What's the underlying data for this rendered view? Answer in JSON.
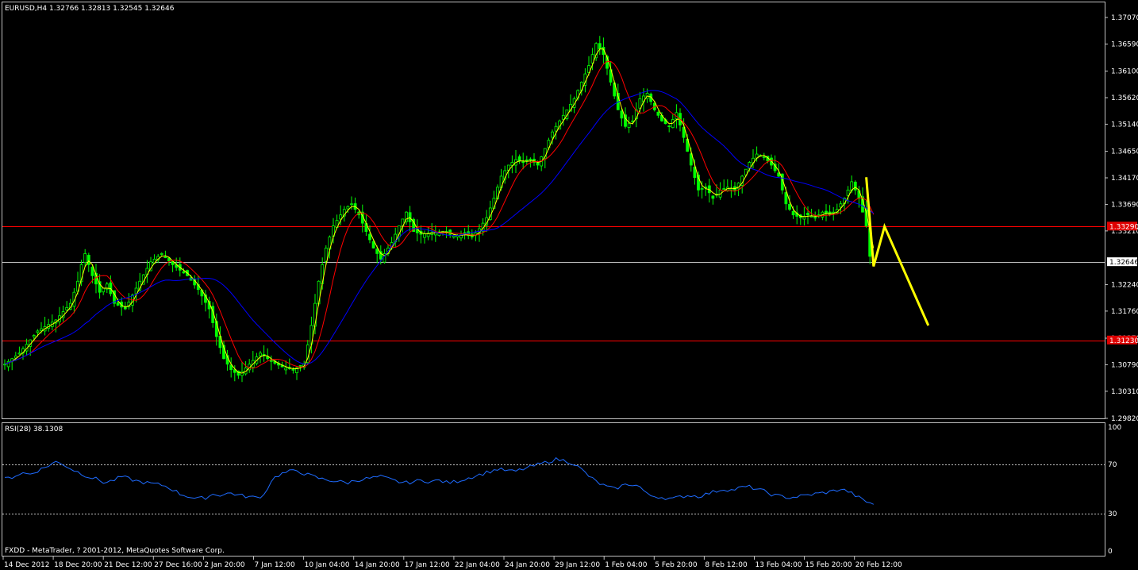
{
  "window": {
    "header": "EURUSD,H4  1.32766 1.32813 1.32545 1.32646",
    "indicator_header": "RSI(28) 38.1308",
    "footer": "FXDD - MetaTrader, ? 2001-2012, MetaQuotes Software Corp."
  },
  "colors": {
    "background": "#000000",
    "frame": "#c0c0c0",
    "candle": "#00ff00",
    "ma_fast": "#ffff00",
    "ma_mid": "#ff0000",
    "ma_slow": "#0000ff",
    "rsi": "#1e6bff",
    "level_line": "#ff0000",
    "current_line": "#c0c0c0",
    "drawing": "#ffff00"
  },
  "chart_data": [
    {
      "type": "candlestick",
      "symbol": "EURUSD",
      "timeframe": "H4",
      "ylim": [
        1.2982,
        1.373
      ],
      "y_ticks": [
        "1.37070",
        "1.36590",
        "1.36100",
        "1.35620",
        "1.35140",
        "1.34650",
        "1.34170",
        "1.33690",
        "1.33210",
        "1.32240",
        "1.31760",
        "1.31270",
        "1.30790",
        "1.30310",
        "1.29820"
      ],
      "y_tick_values": [
        1.3707,
        1.3659,
        1.361,
        1.3562,
        1.3514,
        1.3465,
        1.3417,
        1.3369,
        1.3321,
        1.3224,
        1.3176,
        1.3127,
        1.3079,
        1.3031,
        1.2982
      ],
      "x_ticks": [
        "14 Dec 2012",
        "18 Dec 20:00",
        "21 Dec 12:00",
        "27 Dec 16:00",
        "2 Jan 20:00",
        "7 Jan 12:00",
        "10 Jan 04:00",
        "14 Jan 20:00",
        "17 Jan 12:00",
        "22 Jan 04:00",
        "24 Jan 20:00",
        "29 Jan 12:00",
        "1 Feb 04:00",
        "5 Feb 20:00",
        "8 Feb 12:00",
        "13 Feb 04:00",
        "15 Feb 20:00",
        "20 Feb 12:00"
      ],
      "close_path": [
        [
          0,
          1.308
        ],
        [
          4,
          1.31
        ],
        [
          9,
          1.314
        ],
        [
          14,
          1.316
        ],
        [
          18,
          1.319
        ],
        [
          20,
          1.323
        ],
        [
          21,
          1.326
        ],
        [
          22,
          1.328
        ],
        [
          24,
          1.324
        ],
        [
          26,
          1.321
        ],
        [
          28,
          1.3225
        ],
        [
          30,
          1.319
        ],
        [
          33,
          1.318
        ],
        [
          37,
          1.323
        ],
        [
          40,
          1.3265
        ],
        [
          43,
          1.328
        ],
        [
          46,
          1.326
        ],
        [
          50,
          1.324
        ],
        [
          53,
          1.3215
        ],
        [
          56,
          1.318
        ],
        [
          58,
          1.313
        ],
        [
          60,
          1.309
        ],
        [
          62,
          1.307
        ],
        [
          64,
          1.306
        ],
        [
          67,
          1.308
        ],
        [
          70,
          1.31
        ],
        [
          73,
          1.3085
        ],
        [
          76,
          1.3075
        ],
        [
          79,
          1.307
        ],
        [
          82,
          1.308
        ],
        [
          84,
          1.315
        ],
        [
          86,
          1.323
        ],
        [
          88,
          1.329
        ],
        [
          90,
          1.333
        ],
        [
          93,
          1.336
        ],
        [
          95,
          1.337
        ],
        [
          97,
          1.335
        ],
        [
          99,
          1.332
        ],
        [
          101,
          1.329
        ],
        [
          103,
          1.327
        ],
        [
          106,
          1.33
        ],
        [
          108,
          1.333
        ],
        [
          110,
          1.3355
        ],
        [
          112,
          1.332
        ],
        [
          114,
          1.3315
        ],
        [
          117,
          1.3318
        ],
        [
          120,
          1.332
        ],
        [
          123,
          1.3312
        ],
        [
          126,
          1.3315
        ],
        [
          128,
          1.331
        ],
        [
          130,
          1.3325
        ],
        [
          132,
          1.3345
        ],
        [
          134,
          1.338
        ],
        [
          136,
          1.342
        ],
        [
          138,
          1.344
        ],
        [
          140,
          1.345
        ],
        [
          142,
          1.3445
        ],
        [
          144,
          1.345
        ],
        [
          146,
          1.344
        ],
        [
          148,
          1.347
        ],
        [
          150,
          1.35
        ],
        [
          152,
          1.352
        ],
        [
          154,
          1.354
        ],
        [
          156,
          1.356
        ],
        [
          158,
          1.359
        ],
        [
          160,
          1.362
        ],
        [
          162,
          1.366
        ],
        [
          164,
          1.364
        ],
        [
          166,
          1.359
        ],
        [
          168,
          1.354
        ],
        [
          170,
          1.351
        ],
        [
          172,
          1.352
        ],
        [
          174,
          1.356
        ],
        [
          176,
          1.357
        ],
        [
          178,
          1.354
        ],
        [
          180,
          1.352
        ],
        [
          182,
          1.351
        ],
        [
          184,
          1.3535
        ],
        [
          186,
          1.349
        ],
        [
          188,
          1.344
        ],
        [
          190,
          1.3395
        ],
        [
          192,
          1.34
        ],
        [
          194,
          1.338
        ],
        [
          196,
          1.3395
        ],
        [
          198,
          1.34
        ],
        [
          200,
          1.3395
        ],
        [
          202,
          1.342
        ],
        [
          204,
          1.3445
        ],
        [
          206,
          1.346
        ],
        [
          208,
          1.3455
        ],
        [
          210,
          1.344
        ],
        [
          212,
          1.342
        ],
        [
          214,
          1.337
        ],
        [
          216,
          1.335
        ],
        [
          218,
          1.3345
        ],
        [
          220,
          1.335
        ],
        [
          222,
          1.3345
        ],
        [
          224,
          1.3355
        ],
        [
          226,
          1.335
        ],
        [
          228,
          1.336
        ],
        [
          230,
          1.338
        ],
        [
          232,
          1.341
        ],
        [
          234,
          1.338
        ],
        [
          236,
          1.333
        ],
        [
          237,
          1.3275
        ],
        [
          238,
          1.3265
        ]
      ],
      "horizontal_levels": [
        {
          "value": 1.3329,
          "label": "1.33290",
          "style": "level"
        },
        {
          "value": 1.3123,
          "label": "1.31230",
          "style": "level"
        },
        {
          "value": 1.32646,
          "label": "1.32646",
          "style": "current"
        }
      ],
      "drawing": {
        "type": "zigzag-projection",
        "points": [
          [
            236,
            1.3418
          ],
          [
            238,
            1.3257
          ],
          [
            241,
            1.3329
          ],
          [
            253,
            1.315
          ]
        ]
      }
    },
    {
      "type": "line",
      "title": "RSI(28) 38.1308",
      "ylim": [
        0,
        100
      ],
      "y_ticks": [
        "100",
        "70",
        "30",
        "0"
      ],
      "y_tick_values": [
        100,
        70,
        30,
        0
      ],
      "levels": [
        70,
        30
      ],
      "series": [
        {
          "values": [
            58,
            60,
            63,
            62,
            65,
            68,
            72,
            70,
            66,
            63,
            60,
            58,
            55,
            57,
            60,
            58,
            56,
            55,
            54,
            53,
            50,
            46,
            44,
            42,
            43,
            46,
            45,
            47,
            45,
            44,
            43,
            45,
            58,
            62,
            64,
            65,
            62,
            60,
            58,
            57,
            56,
            55,
            57,
            58,
            59,
            60,
            58,
            56,
            55,
            56,
            57,
            56,
            57,
            55,
            56,
            58,
            60,
            62,
            64,
            66,
            65,
            64,
            66,
            68,
            70,
            72,
            74,
            73,
            71,
            66,
            60,
            55,
            52,
            50,
            53,
            54,
            52,
            45,
            44,
            43,
            42,
            44,
            45,
            44,
            46,
            48,
            50,
            49,
            51,
            52,
            50,
            48,
            45,
            44,
            43,
            44,
            45,
            46,
            47,
            48,
            50,
            48,
            44,
            40,
            38
          ]
        }
      ]
    }
  ]
}
